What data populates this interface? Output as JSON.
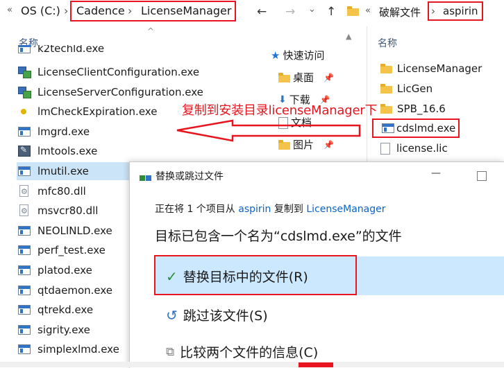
{
  "left_explorer": {
    "breadcrumb": {
      "prefix": "«",
      "drive": "OS (C:)",
      "sep": "›",
      "part1": "Cadence",
      "part2": "LicenseManager"
    },
    "column_header": "名称",
    "sort_indicator": "^",
    "files": [
      {
        "name": "k2techld.exe",
        "icon": "exe-icon"
      },
      {
        "name": "LicenseClientConfiguration.exe",
        "icon": "network-config-icon"
      },
      {
        "name": "LicenseServerConfiguration.exe",
        "icon": "network-config-icon"
      },
      {
        "name": "lmCheckExpiration.exe",
        "icon": "yellow-dot-icon"
      },
      {
        "name": "lmgrd.exe",
        "icon": "exe-icon"
      },
      {
        "name": "lmtools.exe",
        "icon": "lmtools-icon"
      },
      {
        "name": "lmutil.exe",
        "icon": "exe-icon"
      },
      {
        "name": "mfc80.dll",
        "icon": "dll-icon"
      },
      {
        "name": "msvcr80.dll",
        "icon": "dll-icon"
      },
      {
        "name": "NEOLINLD.exe",
        "icon": "exe-icon"
      },
      {
        "name": "perf_test.exe",
        "icon": "exe-icon"
      },
      {
        "name": "platod.exe",
        "icon": "exe-icon"
      },
      {
        "name": "qtdaemon.exe",
        "icon": "exe-icon"
      },
      {
        "name": "qtrekd.exe",
        "icon": "exe-icon"
      },
      {
        "name": "sigrity.exe",
        "icon": "exe-icon"
      },
      {
        "name": "simplexlmd.exe",
        "icon": "exe-icon"
      }
    ]
  },
  "right_explorer": {
    "nav": {
      "back": "←",
      "forward": "→",
      "dropdown": "⌄",
      "up": "↑"
    },
    "breadcrumb": {
      "prefix": "«",
      "parent": "破解文件",
      "sep": "›",
      "current": "aspirin"
    },
    "column_header": "名称",
    "quick_access": {
      "title": "快速访问",
      "items": [
        {
          "label": "桌面"
        },
        {
          "label": "下载"
        },
        {
          "label": "文档"
        },
        {
          "label": "图片"
        }
      ]
    },
    "files": [
      {
        "name": "LicenseManager",
        "icon": "folder-icon"
      },
      {
        "name": "LicGen",
        "icon": "folder-icon"
      },
      {
        "name": "SPB_16.6",
        "icon": "folder-icon"
      },
      {
        "name": "cdslmd.exe",
        "icon": "exe-icon"
      },
      {
        "name": "license.lic",
        "icon": "file-icon"
      }
    ]
  },
  "annotation": {
    "text": "复制到安装目录licenseManager下",
    "color": "#e8141e"
  },
  "dialog": {
    "title": "替换或跳过文件",
    "minimize": "—",
    "status_prefix": "正在将 1 个项目从 ",
    "status_source": "aspirin",
    "status_middle": " 复制到 ",
    "status_target": "LicenseManager",
    "heading": "目标已包含一个名为“cdslmd.exe”的文件",
    "options": [
      {
        "label": "替换目标中的文件(R)",
        "icon": "checkmark-icon"
      },
      {
        "label": "跳过该文件(S)",
        "icon": "skip-arrow-icon"
      },
      {
        "label": "比较两个文件的信息(C)",
        "icon": "compare-icon"
      }
    ]
  },
  "colors": {
    "annotation_red": "#e8141e",
    "selection_blue": "#cce4f7",
    "link_blue": "#0a63c9",
    "header_blue": "#3c5a80",
    "check_green": "#2e8b3a"
  }
}
